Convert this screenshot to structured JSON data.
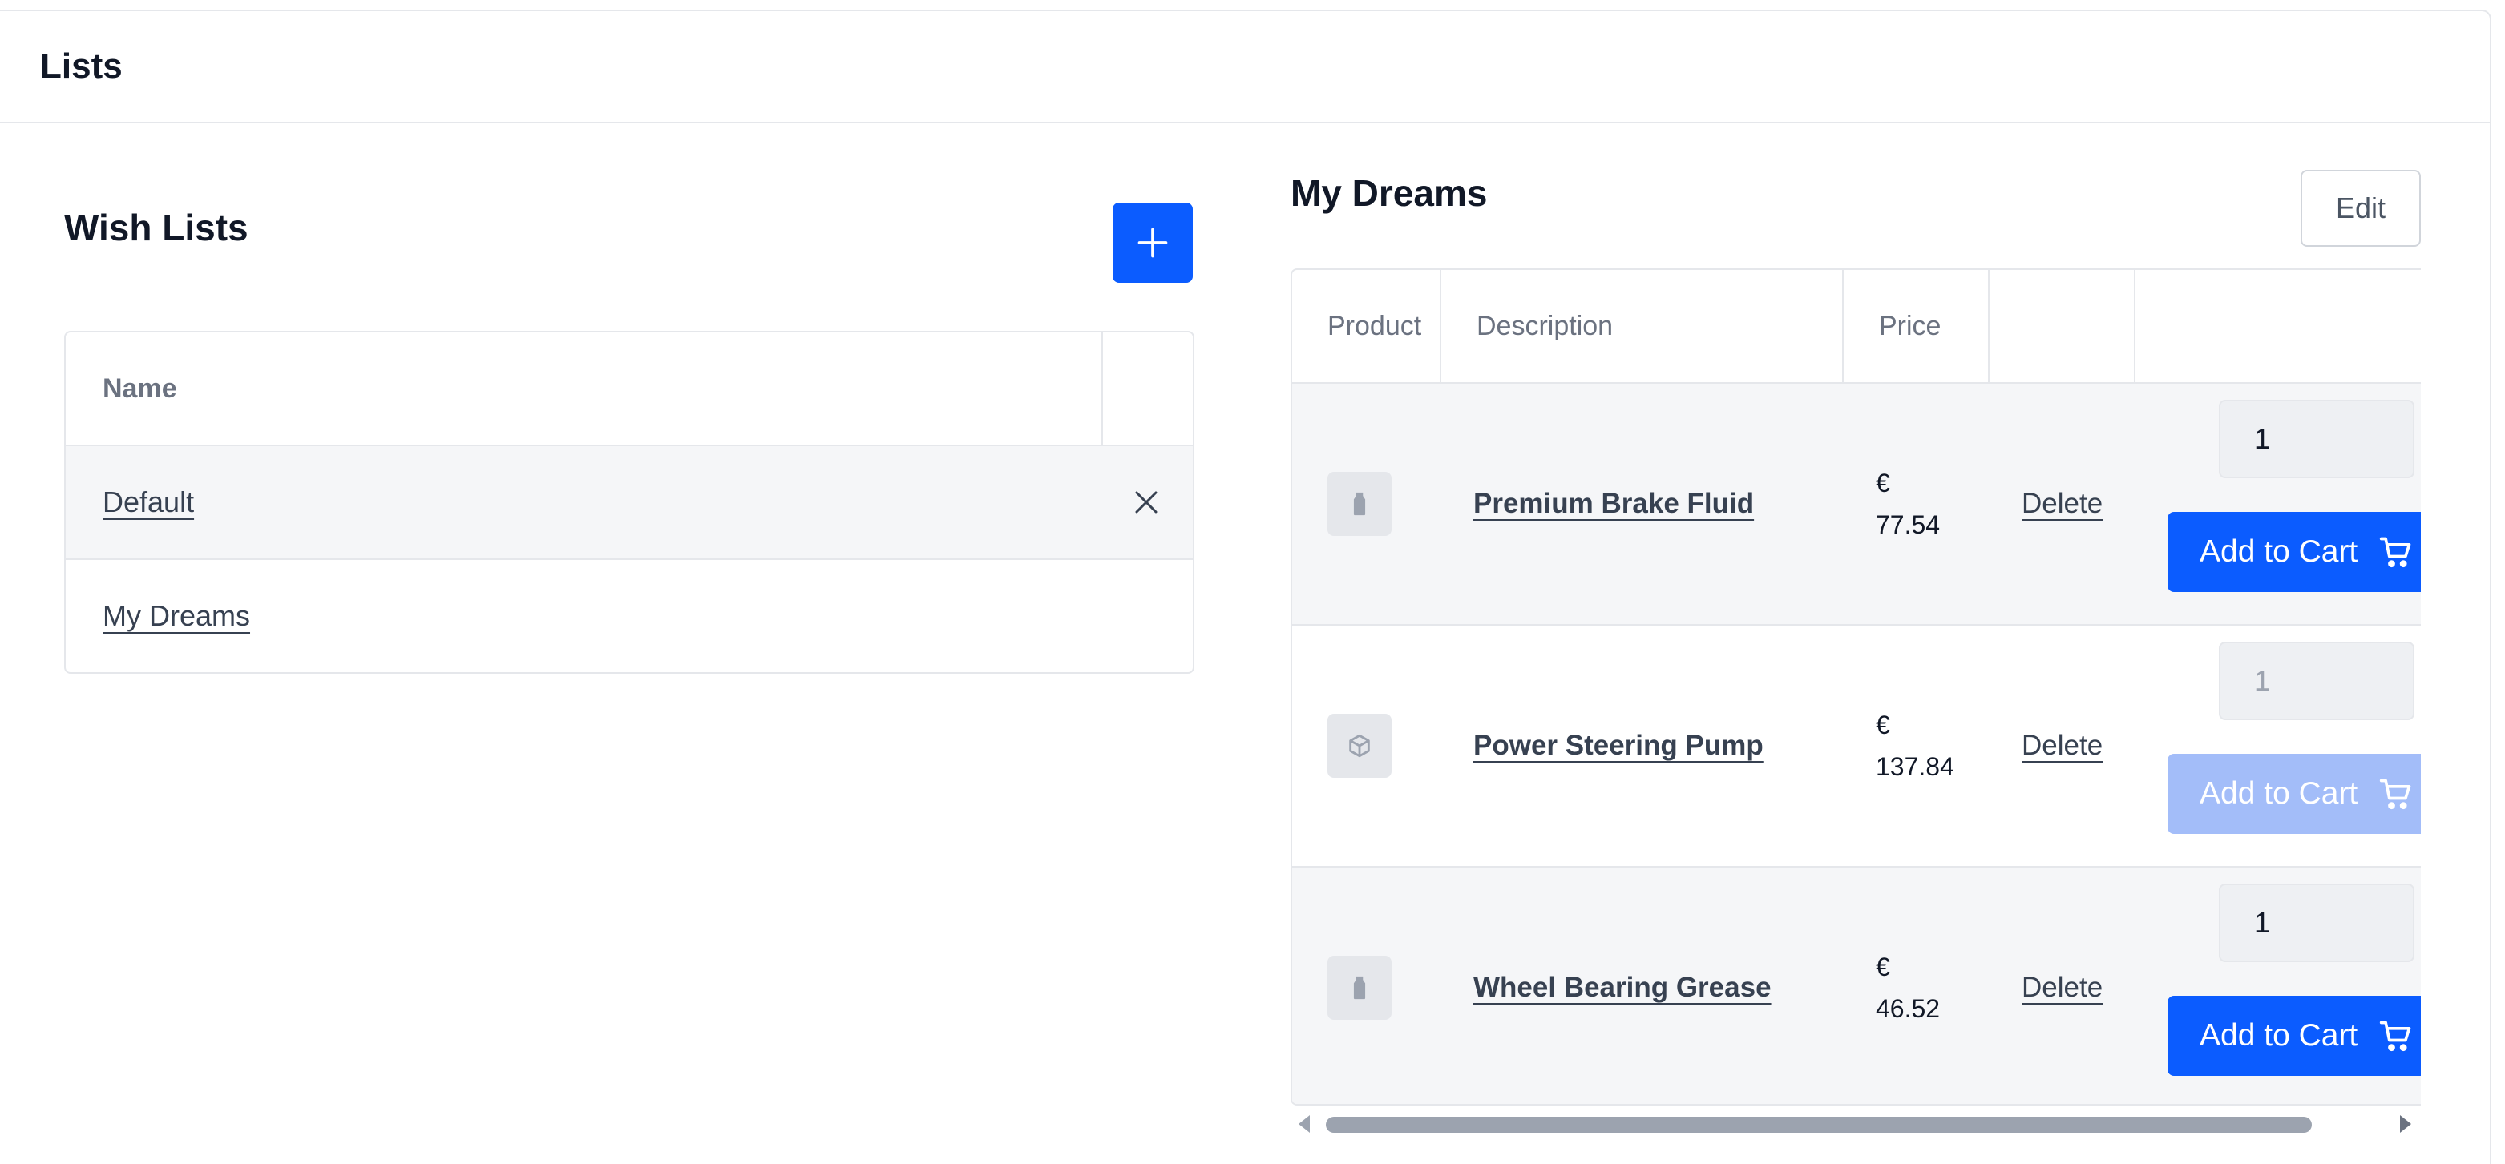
{
  "page": {
    "title": "Lists"
  },
  "wishlists": {
    "title": "Wish Lists",
    "add_icon": "plus-icon",
    "table": {
      "name_header": "Name",
      "rows": [
        {
          "name": "Default",
          "removable": true
        },
        {
          "name": "My Dreams",
          "removable": false
        }
      ]
    }
  },
  "detail": {
    "title": "My Dreams",
    "edit_label": "Edit",
    "columns": {
      "product": "Product",
      "description": "Description",
      "price": "Price",
      "delete": "",
      "actions": ""
    },
    "items": [
      {
        "icon": "bottle-icon",
        "name": "Premium Brake Fluid",
        "currency": "€",
        "price": "77.54",
        "delete_label": "Delete",
        "quantity": "1",
        "cart_label": "Add to Cart",
        "enabled": true
      },
      {
        "icon": "box-icon",
        "name": "Power Steering Pump",
        "currency": "€",
        "price": "137.84",
        "delete_label": "Delete",
        "quantity": "1",
        "cart_label": "Add to Cart",
        "enabled": false
      },
      {
        "icon": "bottle-icon",
        "name": "Wheel Bearing Grease",
        "currency": "€",
        "price": "46.52",
        "delete_label": "Delete",
        "quantity": "1",
        "cart_label": "Add to Cart",
        "enabled": true
      }
    ]
  },
  "colors": {
    "primary": "#0b5cff",
    "primary_disabled": "#a3bdf9",
    "row_shade": "#f5f6f8",
    "border": "#e5e7eb"
  }
}
